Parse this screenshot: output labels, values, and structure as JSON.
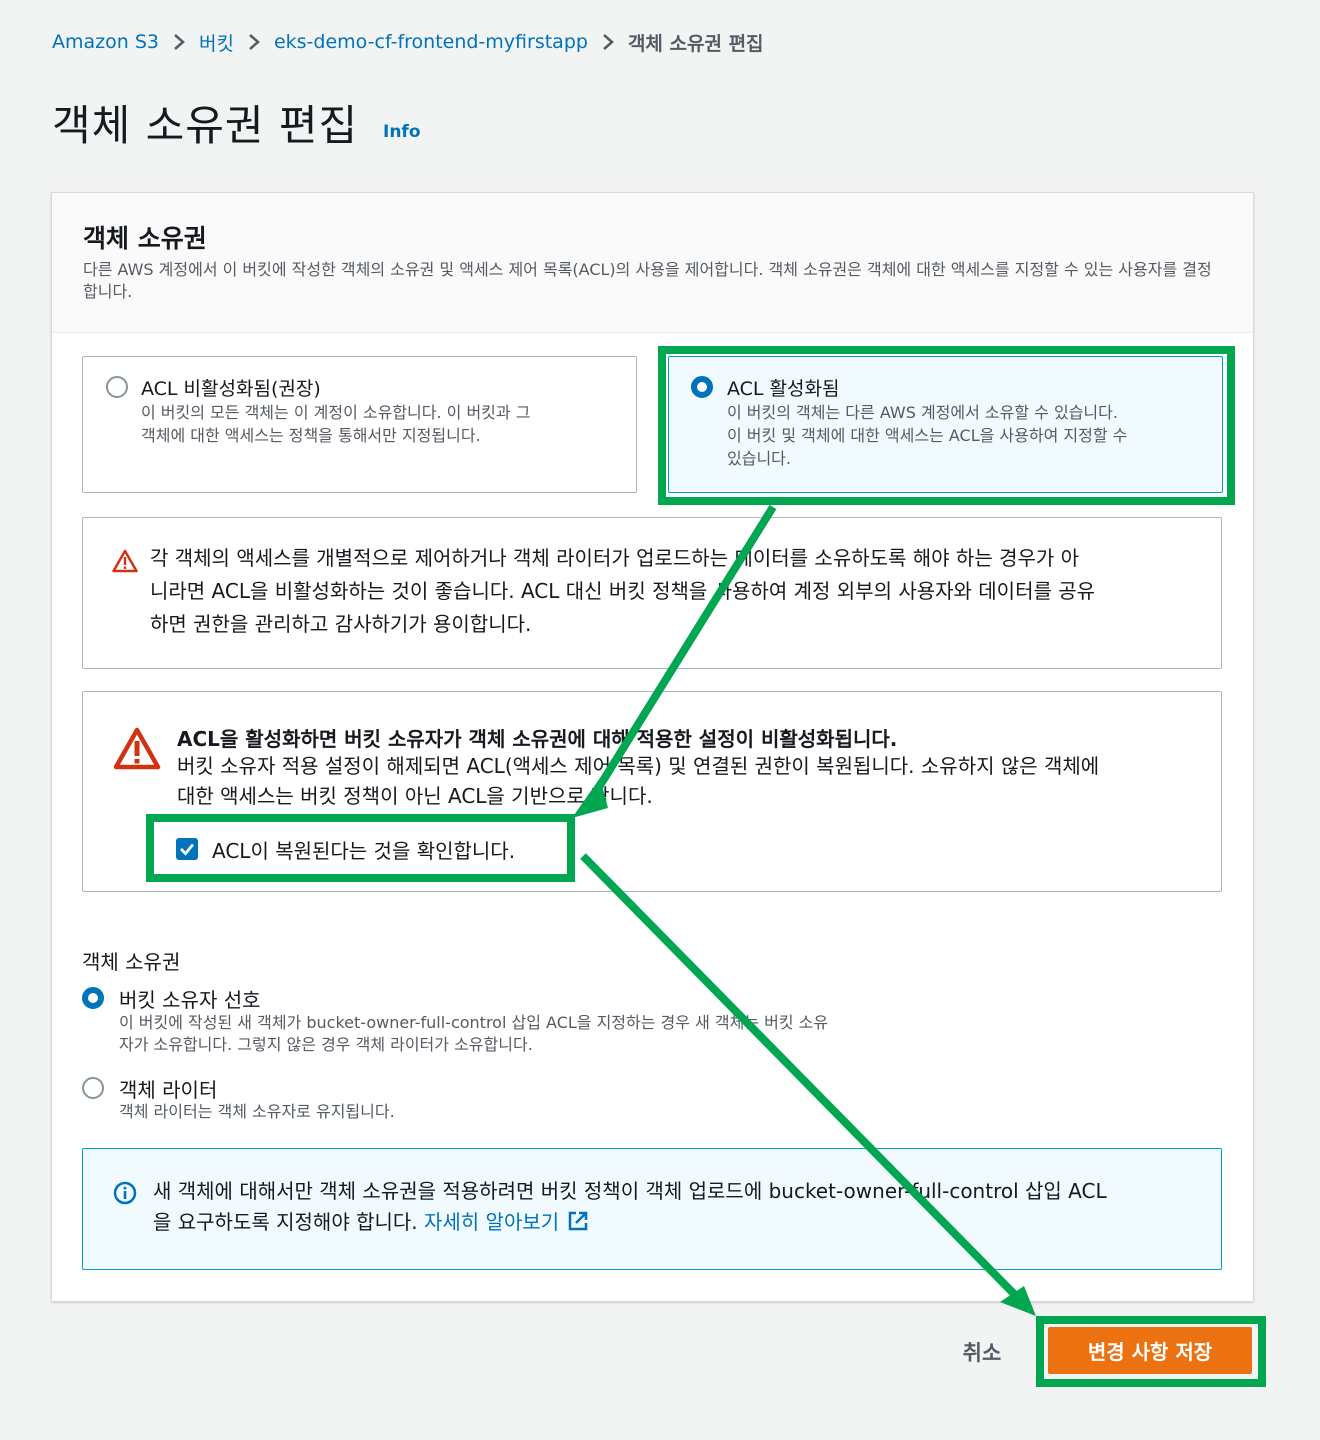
{
  "breadcrumb": {
    "items": [
      "Amazon S3",
      "버킷",
      "eks-demo-cf-frontend-myfirstapp"
    ],
    "current": "객체 소유권 편집"
  },
  "page": {
    "title": "객체 소유권 편집",
    "info_label": "Info"
  },
  "panel": {
    "title": "객체 소유권",
    "description": "다른 AWS 계정에서 이 버킷에 작성한 객체의 소유권 및 액세스 제어 목록(ACL)의 사용을 제어합니다. 객체 소유권은 객체에 대한 액세스를 지정할 수 있는 사용자를 결정합니다."
  },
  "acl_options": [
    {
      "title": "ACL 비활성화됨(권장)",
      "desc_line1": "이 버킷의 모든 객체는 이 계정이 소유합니다. 이 버킷과 그",
      "desc_line2": "객체에 대한 액세스는 정책을 통해서만 지정됩니다.",
      "selected": false
    },
    {
      "title": "ACL 활성화됨",
      "desc_line1": "이 버킷의 객체는 다른 AWS 계정에서 소유할 수 있습니다.",
      "desc_line2": "이 버킷 및 객체에 대한 액세스는 ACL을 사용하여 지정할 수",
      "desc_line3": "있습니다.",
      "selected": true
    }
  ],
  "warning_recommend": {
    "line1": "각 객체의 액세스를 개별적으로 제어하거나 객체 라이터가 업로드하는 데이터를 소유하도록 해야 하는 경우가 아",
    "line2": "니라면 ACL을 비활성화하는 것이 좋습니다. ACL 대신 버킷 정책을 사용하여 계정 외부의 사용자와 데이터를 공유",
    "line3": "하면 권한을 관리하고 감사하기가 용이합니다."
  },
  "warning_acl": {
    "heading": "ACL을 활성화하면 버킷 소유자가 객체 소유권에 대해 적용한 설정이 비활성화됩니다.",
    "line1": "버킷 소유자 적용 설정이 해제되면 ACL(액세스 제어 목록) 및 연결된 권한이 복원됩니다. 소유하지 않은 객체에",
    "line2": "대한 액세스는 버킷 정책이 아닌 ACL을 기반으로 합니다.",
    "confirm_label": "ACL이 복원된다는 것을 확인합니다.",
    "confirm_checked": true
  },
  "ownership": {
    "label": "객체 소유권",
    "options": [
      {
        "title": "버킷 소유자 선호",
        "desc_line1": "이 버킷에 작성된 새 객체가 bucket-owner-full-control 삽입 ACL을 지정하는 경우 새 객체는 버킷 소유",
        "desc_line2": "자가 소유합니다. 그렇지 않은 경우 객체 라이터가 소유합니다.",
        "selected": true
      },
      {
        "title": "객체 라이터",
        "desc_line1": "객체 라이터는 객체 소유자로 유지됩니다.",
        "selected": false
      }
    ]
  },
  "info_box": {
    "line1": "새 객체에 대해서만 객체 소유권을 적용하려면 버킷 정책이 객체 업로드에 bucket-owner-full-control 삽입 ACL",
    "line2": "을 요구하도록 지정해야 합니다. ",
    "link": "자세히 알아보기"
  },
  "actions": {
    "cancel": "취소",
    "save": "변경 사항 저장"
  },
  "colors": {
    "link": "#0073bb",
    "primary_button": "#ec7211",
    "highlight": "#00a650",
    "warning": "#d13212"
  }
}
